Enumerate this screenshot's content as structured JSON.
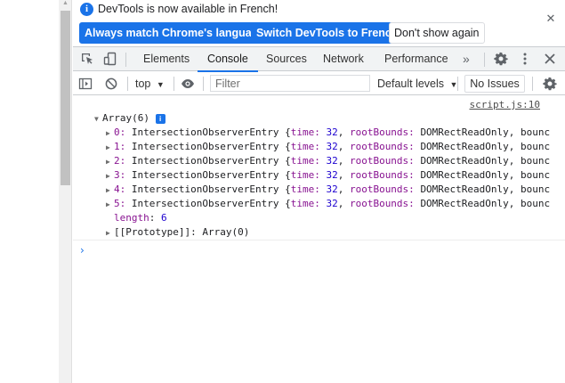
{
  "infobar": {
    "message": "DevTools is now available in French!",
    "btn_match": "Always match Chrome's language",
    "btn_switch": "Switch DevTools to French",
    "btn_dont_show": "Don't show again",
    "close_glyph": "✕"
  },
  "tabs": {
    "items": [
      {
        "label": "Elements"
      },
      {
        "label": "Console"
      },
      {
        "label": "Sources"
      },
      {
        "label": "Network"
      },
      {
        "label": "Performance"
      }
    ],
    "active": "Console",
    "more_glyph": "»"
  },
  "console_toolbar": {
    "context": "top",
    "filter_placeholder": "Filter",
    "levels": "Default levels",
    "issues": "No Issues"
  },
  "log": {
    "source": "script.js:10",
    "array_label": "Array(6)",
    "badge": "i",
    "entries": [
      {
        "index": "0:",
        "type": "IntersectionObserverEntry",
        "time_key": "time:",
        "time_value": "32",
        "bounds": "rootBounds:",
        "bounds_value": "DOMRectReadOnly, bounc"
      },
      {
        "index": "1:",
        "type": "IntersectionObserverEntry",
        "time_key": "time:",
        "time_value": "32",
        "bounds": "rootBounds:",
        "bounds_value": "DOMRectReadOnly, bounc"
      },
      {
        "index": "2:",
        "type": "IntersectionObserverEntry",
        "time_key": "time:",
        "time_value": "32",
        "bounds": "rootBounds:",
        "bounds_value": "DOMRectReadOnly, bounc"
      },
      {
        "index": "3:",
        "type": "IntersectionObserverEntry",
        "time_key": "time:",
        "time_value": "32",
        "bounds": "rootBounds:",
        "bounds_value": "DOMRectReadOnly, bounc"
      },
      {
        "index": "4:",
        "type": "IntersectionObserverEntry",
        "time_key": "time:",
        "time_value": "32",
        "bounds": "rootBounds:",
        "bounds_value": "DOMRectReadOnly, bounc"
      },
      {
        "index": "5:",
        "type": "IntersectionObserverEntry",
        "time_key": "time:",
        "time_value": "32",
        "bounds": "rootBounds:",
        "bounds_value": "DOMRectReadOnly, bounc"
      }
    ],
    "length_key": "length",
    "length_value": "6",
    "prototype": "[[Prototype]]: Array(0)"
  },
  "prompt_glyph": "›",
  "colors": {
    "accent": "#1a73e8",
    "key": "#881391",
    "number": "#1c00cf"
  },
  "icons": [
    "inspect-element-icon",
    "device-toggle-icon",
    "settings-gear-icon",
    "kebab-menu-icon",
    "close-devtools-icon",
    "sidebar-toggle-icon",
    "clear-console-icon",
    "eye-icon",
    "settings-gear-icon"
  ]
}
